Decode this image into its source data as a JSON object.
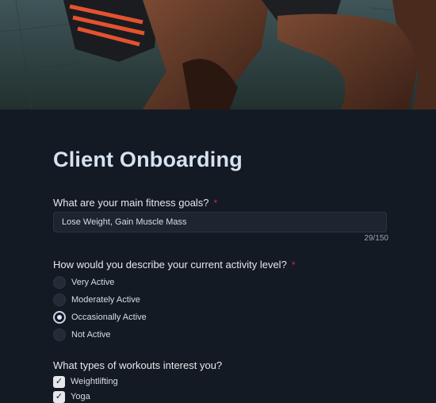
{
  "hero": {
    "image": "athlete-sprint-start-photo"
  },
  "form": {
    "title": "Client Onboarding",
    "goals": {
      "label": "What are your main fitness goals?",
      "required_marker": "*",
      "value": "Lose Weight, Gain Muscle Mass",
      "counter": "29/150"
    },
    "activity": {
      "label": "How would you describe your current activity level?",
      "required_marker": "*",
      "options": [
        {
          "label": "Very Active",
          "checked": false
        },
        {
          "label": "Moderately Active",
          "checked": false
        },
        {
          "label": "Occasionally Active",
          "checked": true
        },
        {
          "label": "Not Active",
          "checked": false
        }
      ]
    },
    "workouts": {
      "label": "What types of workouts interest you?",
      "options": [
        {
          "label": "Weightlifting",
          "checked": true
        },
        {
          "label": "Yoga",
          "checked": true
        }
      ],
      "check_glyph": "✓"
    }
  },
  "colors": {
    "background": "#141a23",
    "required": "#e11d48",
    "accent": "#e2e8f0"
  }
}
